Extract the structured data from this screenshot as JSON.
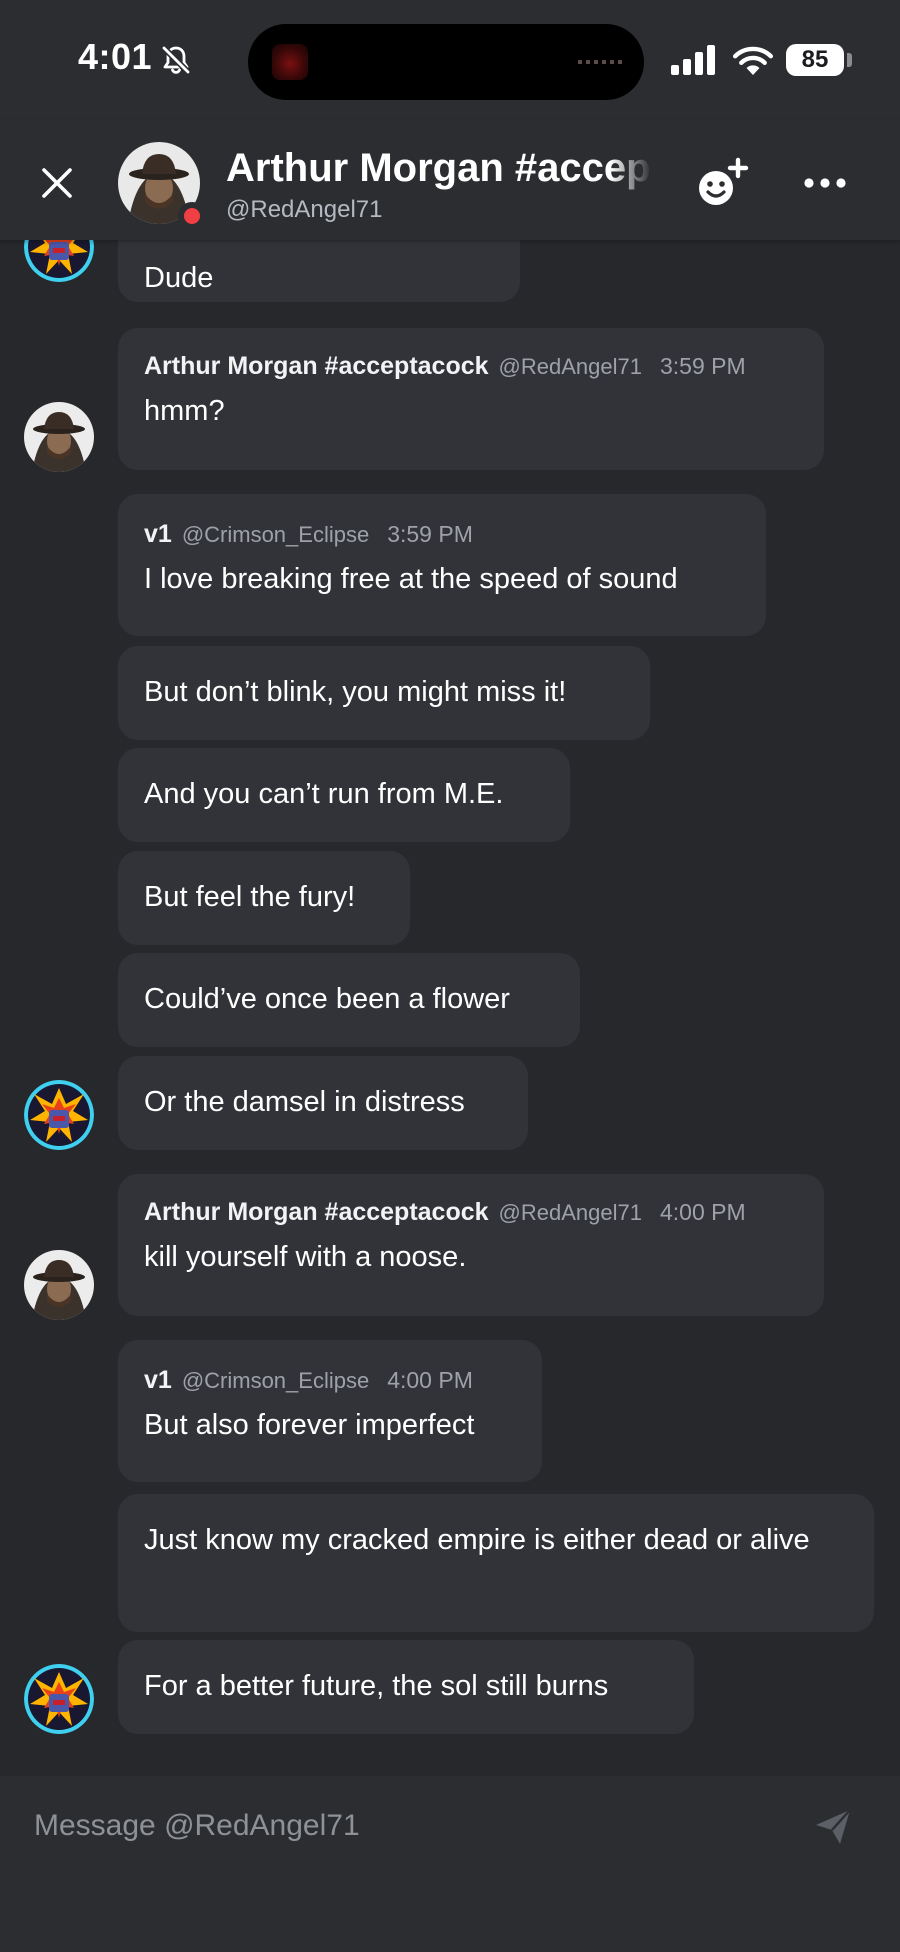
{
  "status_bar": {
    "time": "4:01",
    "battery": "85"
  },
  "header": {
    "name": "Arthur Morgan #acceptacock",
    "handle": "@RedAngel71"
  },
  "messages": [
    {
      "text": "Dude"
    },
    {
      "author": "Arthur Morgan #acceptacock",
      "handle": "@RedAngel71",
      "time": "3:59 PM",
      "text": "hmm?"
    },
    {
      "author": "v1",
      "handle": "@Crimson_Eclipse",
      "time": "3:59 PM",
      "text": "I love breaking free at the speed of sound"
    },
    {
      "text": "But don’t blink, you might miss it!"
    },
    {
      "text": "And you can’t run from M.E."
    },
    {
      "text": "But feel the fury!"
    },
    {
      "text": "Could’ve once been a flower"
    },
    {
      "text": "Or the damsel in distress"
    },
    {
      "author": "Arthur Morgan #acceptacock",
      "handle": "@RedAngel71",
      "time": "4:00 PM",
      "text": "kill yourself with a noose."
    },
    {
      "author": "v1",
      "handle": "@Crimson_Eclipse",
      "time": "4:00 PM",
      "text": "But also forever imperfect"
    },
    {
      "text": "Just know my cracked empire is either dead or alive"
    },
    {
      "text": "For a better future, the sol still burns"
    }
  ],
  "composer": {
    "placeholder": "Message @RedAngel71"
  },
  "colors": {
    "background": "#26282c",
    "bubble": "#313338",
    "header": "#2b2d31",
    "status_dot": "#f23f43",
    "muted_text": "#9ea2a8"
  },
  "icons": {
    "close": "close-icon",
    "add_reaction": "add-friend-icon",
    "more": "more-icon",
    "send": "send-icon",
    "mute": "bell-slash-icon",
    "signal": "cellular-signal-icon",
    "wifi": "wifi-icon"
  }
}
